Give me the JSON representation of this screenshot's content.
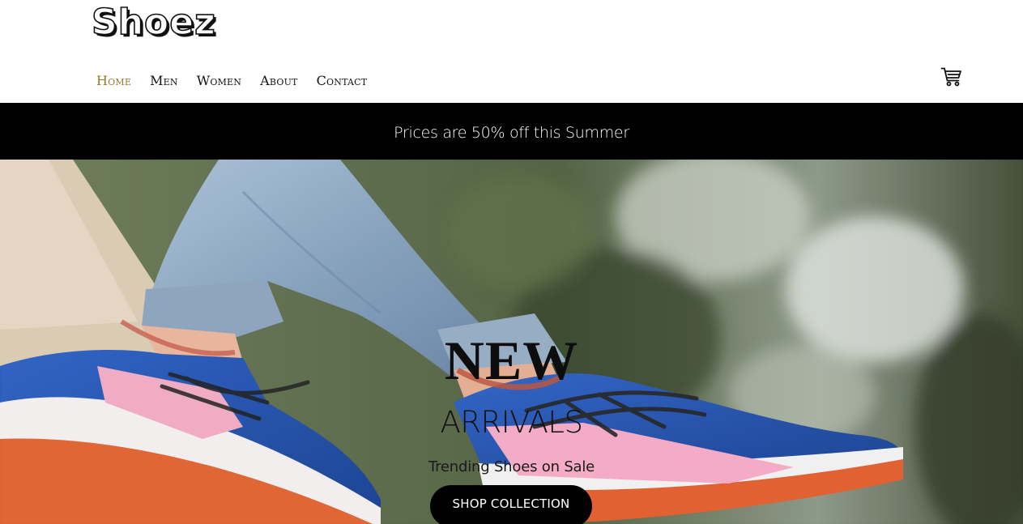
{
  "brand": {
    "logo_text": "Shoez"
  },
  "nav": {
    "items": [
      {
        "label": "Home",
        "active": true
      },
      {
        "label": "Men",
        "active": false
      },
      {
        "label": "Women",
        "active": false
      },
      {
        "label": "About",
        "active": false
      },
      {
        "label": "Contact",
        "active": false
      }
    ],
    "active_color": "#9a7a2a",
    "cart_icon": "shopping-cart-icon"
  },
  "promo": {
    "text": "Prices are 50% off this Summer"
  },
  "hero": {
    "image": "photo of legs in rolled blue jeans wearing blue and pink sneakers with orange soles",
    "title": "NEW",
    "subtitle": "ARRIVALS",
    "tagline": "Trending Shoes on Sale",
    "cta_label": "SHOP COLLECTION"
  }
}
